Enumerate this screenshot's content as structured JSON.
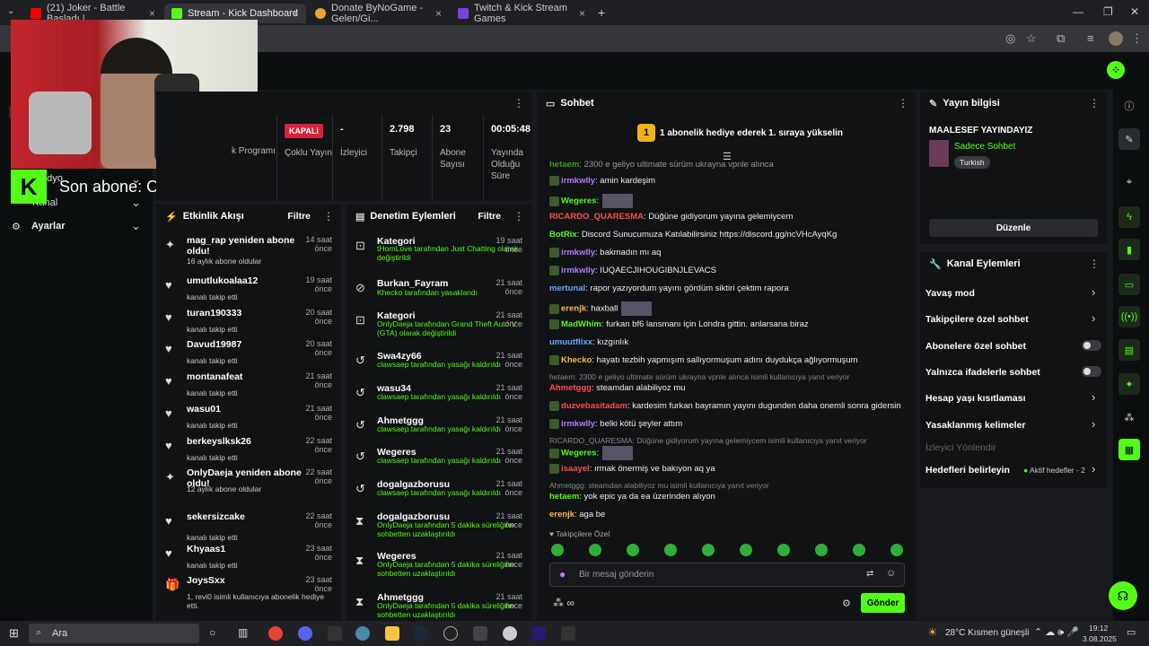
{
  "browser": {
    "tabs": [
      {
        "label": "(21) Joker - Battle Başladı | ..."
      },
      {
        "label": "Stream - Kick Dashboard"
      },
      {
        "label": "Donate ByNoGame - Gelen/Gi..."
      },
      {
        "label": "Twitch & Kick Stream Games"
      }
    ]
  },
  "overlay": {
    "last_sub": "Son abone: OnlyDaeja",
    "partial_nav_1": "adyo",
    "partial_nav_2": "Kanal"
  },
  "sidebar": {
    "settings_label": "Ayarlar"
  },
  "stats": {
    "program_label": "k Programı",
    "status": "KAPALI",
    "status_label": "Çoklu Yayın",
    "viewers_value": "-",
    "viewers_label": "İzleyici",
    "followers_value": "2.798",
    "followers_label": "Takipçi",
    "subs_value": "23",
    "subs_label": "Abone Sayısı",
    "time_value": "00:05:48",
    "time_label": "Yayında Olduğu Süre"
  },
  "activity": {
    "title": "Etkinlik Akışı",
    "filter": "Filtre",
    "items": [
      {
        "name": "mag_rap yeniden abone oldu!",
        "sub": "16 aylık abone oldular",
        "time": "14 saat önce",
        "icon": "sparkle-icon"
      },
      {
        "name": "umutlukoalaa12",
        "sub": "kanalı takip etti",
        "time": "19 saat önce",
        "icon": "heart-icon"
      },
      {
        "name": "turan190333",
        "sub": "kanalı takip etti",
        "time": "20 saat önce",
        "icon": "heart-icon"
      },
      {
        "name": "Davud19987",
        "sub": "kanalı takip etti",
        "time": "20 saat önce",
        "icon": "heart-icon"
      },
      {
        "name": "montanafeat",
        "sub": "kanalı takip etti",
        "time": "21 saat önce",
        "icon": "heart-icon"
      },
      {
        "name": "wasu01",
        "sub": "kanalı takip etti",
        "time": "21 saat önce",
        "icon": "heart-icon"
      },
      {
        "name": "berkeyslksk26",
        "sub": "kanalı takip etti",
        "time": "22 saat önce",
        "icon": "heart-icon"
      },
      {
        "name": "OnlyDaeja yeniden abone oldu!",
        "sub": "12 aylık abone oldular",
        "time": "22 saat önce",
        "icon": "sparkle-icon"
      },
      {
        "name": "sekersizcake",
        "sub": "kanalı takip etti",
        "time": "22 saat önce",
        "icon": "heart-icon"
      },
      {
        "name": "Khyaas1",
        "sub": "kanalı takip etti",
        "time": "23 saat önce",
        "icon": "heart-icon"
      },
      {
        "name": "JoysSxx",
        "sub": "1, revi0 isimli kullanıcıya abonelik hediye etti.",
        "time": "23 saat önce",
        "icon": "gift-icon"
      }
    ]
  },
  "moderation": {
    "title": "Denetim Eylemleri",
    "filter": "Filtre",
    "items": [
      {
        "name": "Kategori",
        "sub": "tHornLove tarafından Just Chatting olarak değiştirildi",
        "time": "19 saat önce",
        "icon": "category-icon"
      },
      {
        "name": "Burkan_Fayram",
        "sub": "Khecko tarafından yasaklandı",
        "time": "21 saat önce",
        "icon": "ban-icon"
      },
      {
        "name": "Kategori",
        "sub": "OnlyDaeja tarafından Grand Theft Auto V (GTA) olarak değiştirildi",
        "time": "21 saat önce",
        "icon": "category-icon"
      },
      {
        "name": "Swa4zy66",
        "sub": "clawsaep tarafından yasağı kaldırıldı",
        "time": "21 saat önce",
        "icon": "undo-icon"
      },
      {
        "name": "wasu34",
        "sub": "clawsaep tarafından yasağı kaldırıldı",
        "time": "21 saat önce",
        "icon": "undo-icon"
      },
      {
        "name": "Ahmetggg",
        "sub": "clawsaep tarafından yasağı kaldırıldı",
        "time": "21 saat önce",
        "icon": "undo-icon"
      },
      {
        "name": "Wegeres",
        "sub": "clawsaep tarafından yasağı kaldırıldı",
        "time": "21 saat önce",
        "icon": "undo-icon"
      },
      {
        "name": "dogalgazborusu",
        "sub": "clawsaep tarafından yasağı kaldırıldı",
        "time": "21 saat önce",
        "icon": "undo-icon"
      },
      {
        "name": "dogalgazborusu",
        "sub": "OnlyDaeja tarafından 5 dakika süreliğine sohbetten uzaklaştırıldı",
        "time": "21 saat önce",
        "icon": "hourglass-icon"
      },
      {
        "name": "Wegeres",
        "sub": "OnlyDaeja tarafından 5 dakika süreliğine sohbetten uzaklaştırıldı",
        "time": "21 saat önce",
        "icon": "hourglass-icon"
      },
      {
        "name": "Ahmetggg",
        "sub": "OnlyDaeja tarafından 5 dakika süreliğine sohbetten uzaklaştırıldı",
        "time": "21 saat önce",
        "icon": "hourglass-icon"
      }
    ]
  },
  "chat": {
    "title": "Sohbet",
    "promo": "1 abonelik hediye ederek 1. sıraya yükselin",
    "promo_count": "1",
    "messages": [
      {
        "user": "hetaem",
        "color": "#53fc18",
        "text": ": 2300 e geliyo ultimate sürüm ukrayna vpnle alınca"
      },
      {
        "user": "irmkwlly",
        "color": "#b47cff",
        "text": ": amin kardeşim"
      },
      {
        "user": "Wegeres",
        "color": "#53fc18",
        "text": ":"
      },
      {
        "user": "RICARDO_QUARESMA",
        "color": "#ff4d4d",
        "text": ": Düğüne gidiyorum yayına gelemiycem"
      },
      {
        "user": "BotRix",
        "color": "#53fc18",
        "text": ": Discord Sunucumuza Katılabilirsiniz https://discord.gg/ncVHcAyqKg"
      },
      {
        "user": "irmkwlly",
        "color": "#b47cff",
        "text": ": bakmadın mı aq"
      },
      {
        "user": "irmkwlly",
        "color": "#b47cff",
        "text": ": IUQAECJIHOUGIBNJLEVACS"
      },
      {
        "user": "mertunal",
        "color": "#6fa8ff",
        "text": ": rapor yazıyordum yayını gördüm siktiri çektim rapora"
      },
      {
        "user": "erenjk",
        "color": "#ffb84d",
        "text": ": haxball"
      },
      {
        "user": "MadWhim",
        "color": "#53fc18",
        "text": ": furkan bf6 lansmanı için Londra gittin. anlarsana biraz"
      },
      {
        "user": "umuutflixx",
        "color": "#6fa8ff",
        "text": ": kızgınlık"
      },
      {
        "user": "Khecko",
        "color": "#ffb84d",
        "text": ": hayatı tezbih yapmışım sallıyormuşum adını duydukça ağlıyormuşum"
      },
      {
        "user": "Ahmetggg",
        "color": "#ff4d4d",
        "text": ": steamdan alabiliyoz mu"
      },
      {
        "user": "duzvebasitadam",
        "color": "#ff4d4d",
        "text": ": kardesim furkan bayramın yayını dugunden daha onemli sonra gidersin"
      },
      {
        "user": "irmkwlly",
        "color": "#b47cff",
        "text": ": belki kötü şeyler attım"
      },
      {
        "user": "Wegeres",
        "color": "#53fc18",
        "text": ":"
      },
      {
        "user": "isaayel",
        "color": "#ff4d4d",
        "text": ": ırmak önermiş ve bakıyon aq ya"
      },
      {
        "user": "hetaem",
        "color": "#53fc18",
        "text": ": yok epic ya da ea üzerinden alıyon"
      },
      {
        "user": "erenjk",
        "color": "#ffb84d",
        "text": ": aga be"
      }
    ],
    "replies": [
      "hetaem: 2300 e geliyo ultimate sürüm ukrayna vpnle alınca isimli kullanıcıya yanıt veriyor",
      "RICARDO_QUARESMA: Düğüne gidiyorum yayına gelemiycem isimli kullanıcıya yanıt veriyor",
      "Ahmetggg: steamdan alabiliyoz mu isimli kullanıcıya yanıt veriyor"
    ],
    "followers_only": "Takipçilere Özel",
    "input_placeholder": "Bir mesaj gönderin",
    "send": "Gönder"
  },
  "stream_info": {
    "title": "Yayın bilgisi",
    "stream_title": "MAALESEF YAYINDAYIZ",
    "category": "Sadece Sohbet",
    "tag": "Turkish",
    "edit": "Düzenle"
  },
  "channel_actions": {
    "title": "Kanal Eylemleri",
    "slow_mode": "Yavaş mod",
    "followers_chat": "Takipçilere özel sohbet",
    "subs_chat": "Abonelere özel sohbet",
    "emote_chat": "Yalnızca ifadelerle sohbet",
    "account_age": "Hesap yaşı kısıtlaması",
    "banned_words": "Yasaklanmış kelimeler",
    "viewer_redirect": "İzleyici Yönlendir",
    "set_goals": "Hedefleri belirleyin",
    "active_goals": "Aktif hedefler - 2"
  },
  "taskbar": {
    "search": "Ara",
    "weather": "28°C  Kısmen güneşli",
    "time": "19:12",
    "date": "3.08.2025"
  }
}
